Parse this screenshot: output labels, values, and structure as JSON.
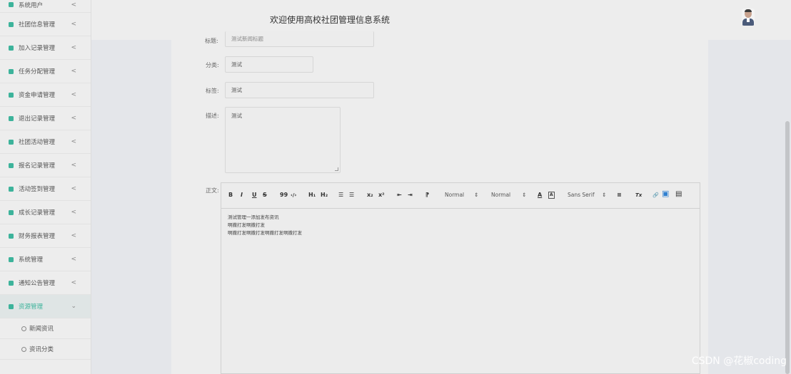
{
  "header": {
    "title": "欢迎使用高校社团管理信息系统"
  },
  "sidebar": {
    "items": [
      {
        "label": "系统用户"
      },
      {
        "label": "社团信息管理"
      },
      {
        "label": "加入记录管理"
      },
      {
        "label": "任务分配管理"
      },
      {
        "label": "资金申请管理"
      },
      {
        "label": "退出记录管理"
      },
      {
        "label": "社团活动管理"
      },
      {
        "label": "报名记录管理"
      },
      {
        "label": "活动签到管理"
      },
      {
        "label": "成长记录管理"
      },
      {
        "label": "财务报表管理"
      },
      {
        "label": "系统管理"
      },
      {
        "label": "通知公告管理"
      },
      {
        "label": "资源管理"
      }
    ],
    "sub_items": [
      {
        "label": "新闻资讯"
      },
      {
        "label": "资讯分类"
      }
    ],
    "collapsed_chevron": "<",
    "expanded_chevron": "⌄"
  },
  "form": {
    "title_label": "标题:",
    "title_value": "测试新闻标题",
    "category_label": "分类:",
    "category_value": "测试",
    "tags_label": "标签:",
    "tags_value": "测试",
    "desc_label": "描述:",
    "desc_value": "测试",
    "body_label": "正文:"
  },
  "editor": {
    "toolbar": {
      "bold": "B",
      "italic": "I",
      "underline": "U",
      "strike": "S",
      "quote": "99",
      "code": "‹/›",
      "h1": "H₁",
      "h2": "H₂",
      "ordered_list": "☰",
      "bullet_list": "☰",
      "subscript": "x₂",
      "superscript": "x²",
      "outdent": "⇤",
      "indent": "⇥",
      "direction": "⁋",
      "size_select": "Normal",
      "header_select": "Normal",
      "color": "A",
      "background": "A",
      "font_select": "Sans Serif",
      "align": "≡",
      "clean": "Tx",
      "link": "🔗",
      "image": "▣",
      "video": "▤",
      "select_arrow": "⇕"
    },
    "content_lines": [
      "测试管理一添加发布资讯",
      "啊撒打发啊撒打发",
      "啊撒打发啊撒打发啊撒打发啊撒打发"
    ]
  },
  "watermark": "CSDN @花椒coding",
  "colors": {
    "accent": "#3db39b",
    "background": "#e4e6ea",
    "panel": "#ededed"
  }
}
